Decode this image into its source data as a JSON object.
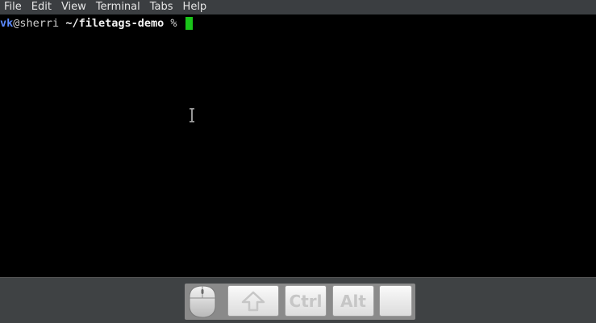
{
  "menubar": {
    "items": [
      {
        "label": "File"
      },
      {
        "label": "Edit"
      },
      {
        "label": "View"
      },
      {
        "label": "Terminal"
      },
      {
        "label": "Tabs"
      },
      {
        "label": "Help"
      }
    ]
  },
  "terminal": {
    "prompt": {
      "user": "vk",
      "at": "@",
      "host": "sherri",
      "path": "~/filetags-demo",
      "symbol": "%"
    },
    "cursor_color": "#19c419"
  },
  "keyboard": {
    "keys": [
      {
        "label": ""
      },
      {
        "label": "Ctrl"
      },
      {
        "label": "Alt"
      },
      {
        "label": ""
      }
    ],
    "icons": {
      "mouse": "mouse-icon",
      "shift": "shift-arrow-icon",
      "ibeam": "text-cursor-icon"
    }
  },
  "colors": {
    "menubar_bg": "#3b3e41",
    "terminal_bg": "#000000",
    "user_color": "#5c8bff",
    "panel_bg": "#3f4244"
  }
}
